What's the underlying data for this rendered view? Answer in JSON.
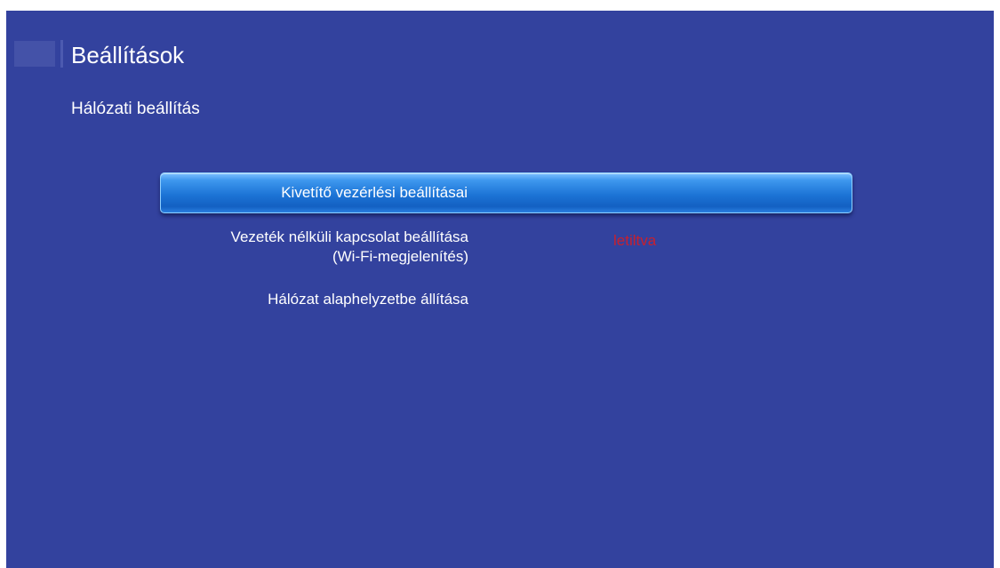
{
  "header": {
    "title": "Beállítások",
    "icon": "settings-block-icon"
  },
  "section": {
    "title": "Hálózati beállítás"
  },
  "menu": {
    "items": [
      {
        "label": "Kivetítő vezérlési beállításai",
        "selected": true
      },
      {
        "label": "Vezeték nélküli kapcsolat beállítása\n(Wi-Fi-megjelenítés)",
        "value": "letiltva",
        "selected": false
      },
      {
        "label": "Hálózat alaphelyzetbe állítása",
        "selected": false
      }
    ]
  },
  "colors": {
    "background": "#33429e",
    "highlight": "#1c74d6",
    "value_disabled": "#c8202e"
  }
}
